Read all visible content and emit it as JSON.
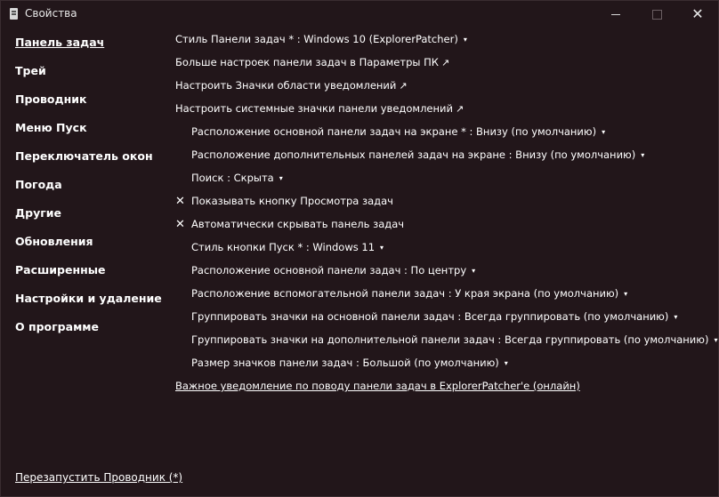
{
  "window": {
    "title": "Свойства"
  },
  "sidebar": {
    "items": [
      {
        "label": "Панель задач",
        "active": true
      },
      {
        "label": "Трей"
      },
      {
        "label": "Проводник"
      },
      {
        "label": "Меню Пуск"
      },
      {
        "label": "Переключатель окон"
      },
      {
        "label": "Погода"
      },
      {
        "label": "Другие"
      },
      {
        "label": "Обновления"
      },
      {
        "label": "Расширенные"
      },
      {
        "label": "Настройки и удаление"
      },
      {
        "label": "О программе"
      }
    ],
    "restart_link": "Перезапустить Проводник (*)"
  },
  "main": {
    "taskbar_style": "Стиль Панели задач * : Windows 10 (ExplorerPatcher)",
    "more_settings": "Больше настроек панели задач в Параметры ПК",
    "tray_icons": "Настроить Значки области уведомлений",
    "system_icons": "Настроить системные значки панели уведомлений",
    "primary_position": "Расположение основной панели задач на экране * : Внизу (по умолчанию)",
    "secondary_position": "Расположение дополнительных панелей задач на экране : Внизу (по умолчанию)",
    "search": "Поиск : Скрыта",
    "task_view": {
      "label": "Показывать кнопку Просмотра задач",
      "mark": "✕"
    },
    "autohide": {
      "label": "Автоматически скрывать панель задач",
      "mark": "✕"
    },
    "start_style": "Стиль кнопки Пуск * : Windows 11",
    "primary_alignment": "Расположение основной панели задач : По центру",
    "secondary_alignment": "Расположение вспомогательной панели задач : У края экрана (по умолчанию)",
    "primary_grouping": "Группировать значки на основной панели задач : Всегда группировать (по умолчанию)",
    "secondary_grouping": "Группировать значки на дополнительной панели задач : Всегда группировать (по умолчанию)",
    "icon_size": "Размер значков панели задач : Большой (по умолчанию)",
    "notice_link": "Важное уведомление по поводу панели задач в ExplorerPatcher'e (онлайн)"
  },
  "glyphs": {
    "caret": "▾",
    "external": "↗"
  },
  "colors": {
    "background": "#22161a",
    "text": "#ffffff"
  }
}
